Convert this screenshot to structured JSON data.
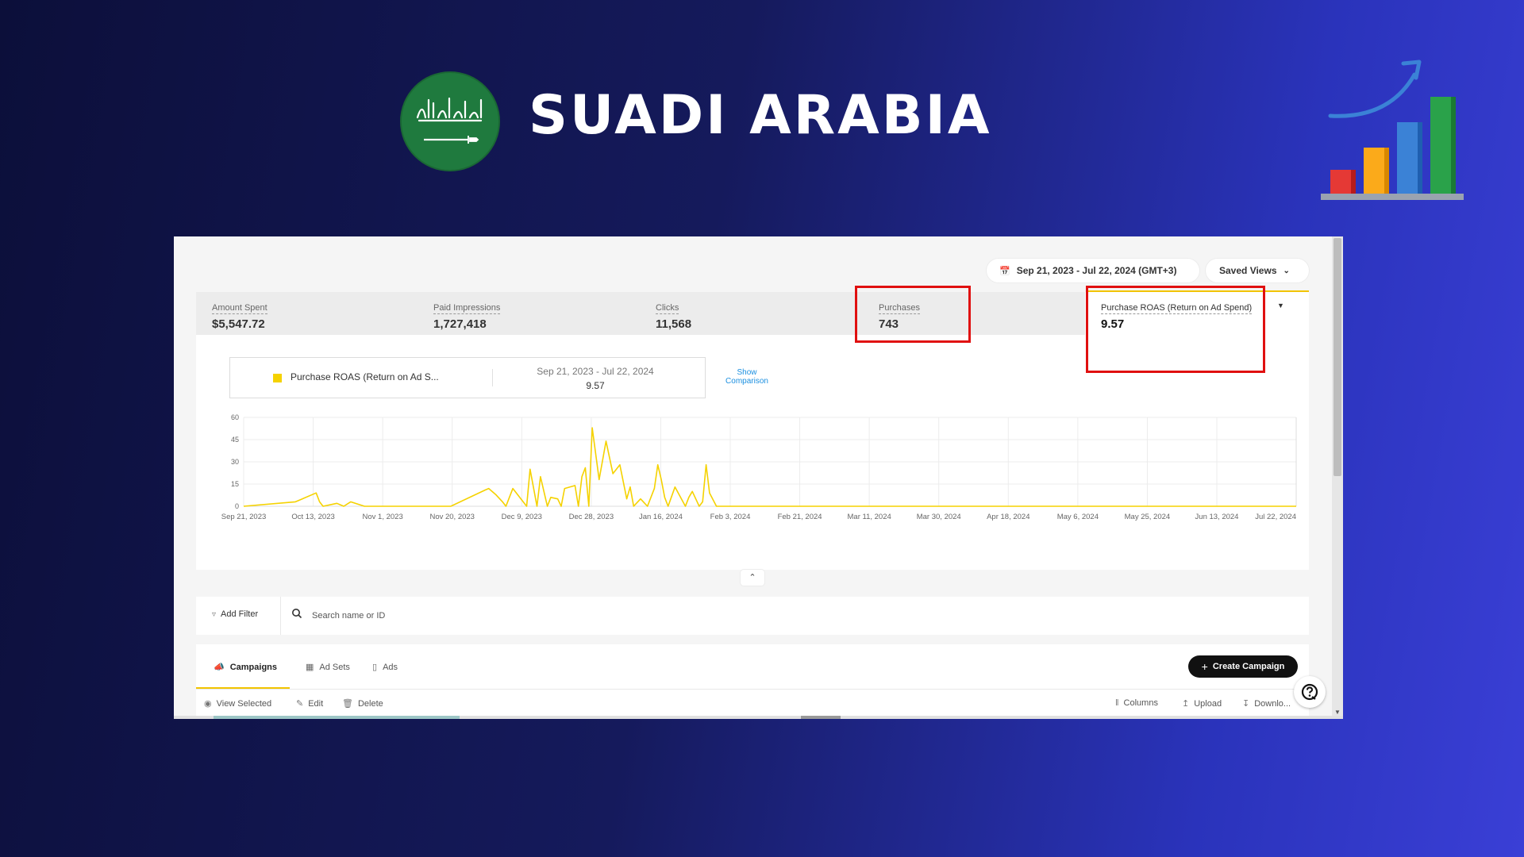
{
  "hero": {
    "title": "SUADI ARABIA",
    "flag_icon": "saudi-flag-icon",
    "growth_icon": "bar-chart-growth-icon"
  },
  "toolbar": {
    "date_range": "Sep 21, 2023 - Jul 22, 2024 (GMT+3)",
    "saved_views": "Saved Views"
  },
  "metrics": [
    {
      "label": "Amount Spent",
      "value": "$5,547.72"
    },
    {
      "label": "Paid Impressions",
      "value": "1,727,418"
    },
    {
      "label": "Clicks",
      "value": "11,568"
    },
    {
      "label": "Purchases",
      "value": "743"
    },
    {
      "label": "Purchase ROAS (Return on Ad Spend)",
      "value": "9.57"
    }
  ],
  "legend": {
    "name": "Purchase ROAS (Return on Ad S...",
    "range": "Sep 21, 2023 - Jul 22, 2024",
    "value": "9.57",
    "show_comparison": "Show Comparison"
  },
  "chart_data": {
    "type": "line",
    "series": [
      {
        "color": "#f5d200",
        "values": []
      }
    ],
    "x_labels": [
      "Sep 21, 2023",
      "Oct 13, 2023",
      "Nov 1, 2023",
      "Nov 20, 2023",
      "Dec 9, 2023",
      "Dec 28, 2023",
      "Jan 16, 2024",
      "Feb 3, 2024",
      "Feb 21, 2024",
      "Mar 11, 2024",
      "Mar 30, 2024",
      "Apr 18, 2024",
      "May 6, 2024",
      "May 25, 2024",
      "Jun 13, 2024",
      "Jul 22, 2024"
    ],
    "y_ticks": [
      0,
      15,
      30,
      45,
      60
    ],
    "ylim": [
      0,
      60
    ],
    "x": [
      "2023-09-21",
      "2023-10-06",
      "2023-10-12",
      "2023-10-13",
      "2023-10-14",
      "2023-10-18",
      "2023-10-20",
      "2023-10-22",
      "2023-10-26",
      "2023-11-01",
      "2023-11-20",
      "2023-11-30",
      "2023-12-01",
      "2023-12-03",
      "2023-12-05",
      "2023-12-06",
      "2023-12-08",
      "2023-12-12",
      "2023-12-13",
      "2023-12-15",
      "2023-12-16",
      "2023-12-18",
      "2023-12-19",
      "2023-12-21",
      "2023-12-22",
      "2023-12-23",
      "2023-12-26",
      "2023-12-27",
      "2023-12-28",
      "2023-12-29",
      "2023-12-30",
      "2023-12-31",
      "2024-01-02",
      "2024-01-04",
      "2024-01-06",
      "2024-01-08",
      "2024-01-10",
      "2024-01-11",
      "2024-01-12",
      "2024-01-14",
      "2024-01-16",
      "2024-01-18",
      "2024-01-19",
      "2024-01-20",
      "2024-01-21",
      "2024-01-22",
      "2024-01-24",
      "2024-01-27",
      "2024-01-28",
      "2024-01-29",
      "2024-01-31",
      "2024-02-01",
      "2024-02-02",
      "2024-02-03",
      "2024-02-05",
      "2024-02-21",
      "2024-07-22"
    ],
    "values": [
      0,
      3,
      9,
      3,
      0,
      2,
      0,
      3,
      0,
      0,
      0,
      11,
      12,
      8,
      3,
      0,
      12,
      0,
      25,
      0,
      20,
      0,
      6,
      5,
      0,
      12,
      14,
      0,
      20,
      26,
      0,
      53,
      18,
      44,
      22,
      28,
      5,
      13,
      0,
      5,
      0,
      12,
      28,
      18,
      6,
      0,
      13,
      0,
      6,
      10,
      0,
      3,
      28,
      9,
      0,
      0,
      0
    ]
  },
  "filter": {
    "add_filter": "Add Filter",
    "search_placeholder": "Search name or ID"
  },
  "tabs": [
    "Campaigns",
    "Ad Sets",
    "Ads"
  ],
  "create_button": "Create Campaign",
  "actions": {
    "view_selected": "View Selected",
    "edit": "Edit",
    "delete": "Delete",
    "columns": "Columns",
    "upload": "Upload",
    "download": "Downlo..."
  },
  "colors": {
    "accent": "#f2c400",
    "highlight": "#e01010",
    "link": "#1a8fe0"
  }
}
